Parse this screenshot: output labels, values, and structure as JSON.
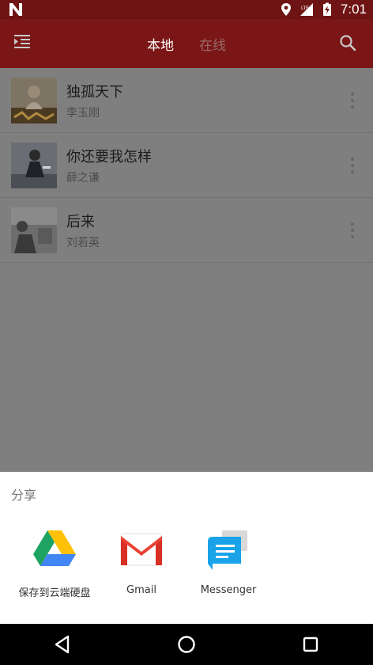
{
  "status_bar": {
    "time": "7:01"
  },
  "app_bar": {
    "tabs": [
      {
        "label": "本地",
        "active": true
      },
      {
        "label": "在线",
        "active": false
      }
    ]
  },
  "songs": [
    {
      "title": "独孤天下",
      "artist": "李玉刚"
    },
    {
      "title": "你还要我怎样",
      "artist": "薛之谦"
    },
    {
      "title": "后来",
      "artist": "刘若英"
    }
  ],
  "share_sheet": {
    "title": "分享",
    "targets": [
      {
        "label": "保存到云端硬盘",
        "icon": "google-drive-icon"
      },
      {
        "label": "Gmail",
        "icon": "gmail-icon"
      },
      {
        "label": "Messenger",
        "icon": "messenger-icon"
      }
    ]
  },
  "colors": {
    "app_bar": "#7b1616",
    "status_bar": "#6f1414",
    "scrim_content": "#7f7f7f"
  }
}
